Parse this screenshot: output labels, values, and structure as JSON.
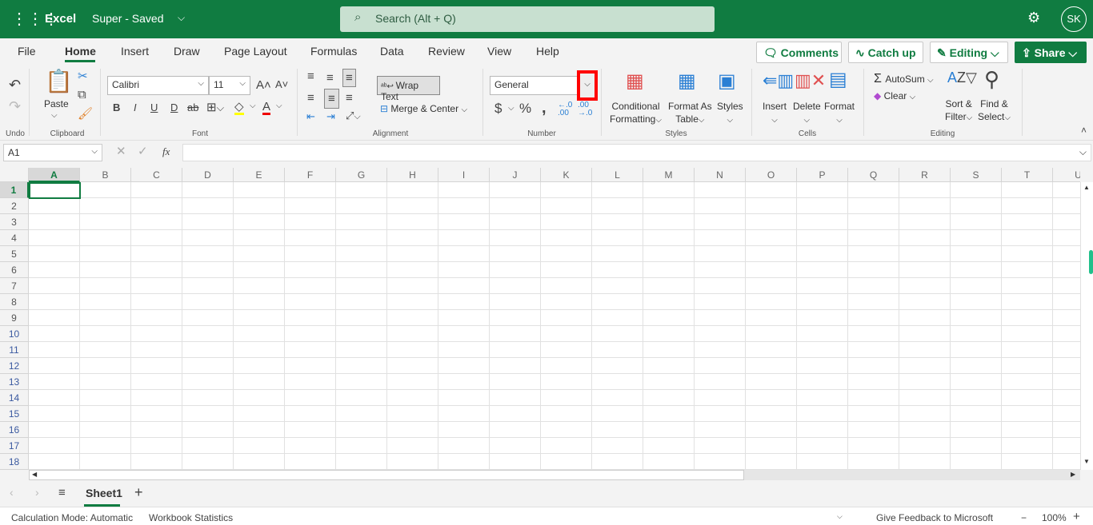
{
  "app": {
    "name": "Excel",
    "doc_title": "Super - Saved",
    "search_placeholder": "Search (Alt + Q)",
    "avatar": "SK"
  },
  "tabs": [
    "File",
    "Home",
    "Insert",
    "Draw",
    "Page Layout",
    "Formulas",
    "Data",
    "Review",
    "View",
    "Help"
  ],
  "top_buttons": {
    "comments": "Comments",
    "catch_up": "Catch up",
    "editing": "Editing",
    "share": "Share"
  },
  "ribbon": {
    "undo_group": "Undo",
    "clipboard_group": "Clipboard",
    "paste": "Paste",
    "font_group": "Font",
    "font_name": "Calibri",
    "font_size": "11",
    "font_buttons": [
      "B",
      "I",
      "U",
      "D",
      "ab"
    ],
    "alignment_group": "Alignment",
    "wrap_text": "Wrap Text",
    "merge_center": "Merge & Center",
    "number_group": "Number",
    "number_format": "General",
    "styles_group": "Styles",
    "conditional_formatting": [
      "Conditional",
      "Formatting"
    ],
    "format_as_table": [
      "Format As",
      "Table"
    ],
    "styles": "Styles",
    "cells_group": "Cells",
    "insert": "Insert",
    "delete": "Delete",
    "format": "Format",
    "editing_group": "Editing",
    "autosum": "AutoSum",
    "clear": "Clear",
    "sort_filter": [
      "Sort &",
      "Filter"
    ],
    "find_select": [
      "Find &",
      "Select"
    ]
  },
  "formula_bar": {
    "name_box": "A1",
    "fx": "fx",
    "value": ""
  },
  "grid": {
    "columns": [
      "A",
      "B",
      "C",
      "D",
      "E",
      "F",
      "G",
      "H",
      "I",
      "J",
      "K",
      "L",
      "M",
      "N",
      "O",
      "P",
      "Q",
      "R",
      "S",
      "T",
      "U"
    ],
    "rows": [
      1,
      2,
      3,
      4,
      5,
      6,
      7,
      8,
      9,
      10,
      11,
      12,
      13,
      14,
      15,
      16,
      17,
      18
    ],
    "selected": "A1"
  },
  "sheets": {
    "tabs": [
      "Sheet1"
    ],
    "active": "Sheet1"
  },
  "status": {
    "calc_mode": "Calculation Mode: Automatic",
    "stats": "Workbook Statistics",
    "feedback": "Give Feedback to Microsoft",
    "zoom": "100%"
  },
  "colors": {
    "brand": "#107c41",
    "highlight": "#ff0000"
  }
}
